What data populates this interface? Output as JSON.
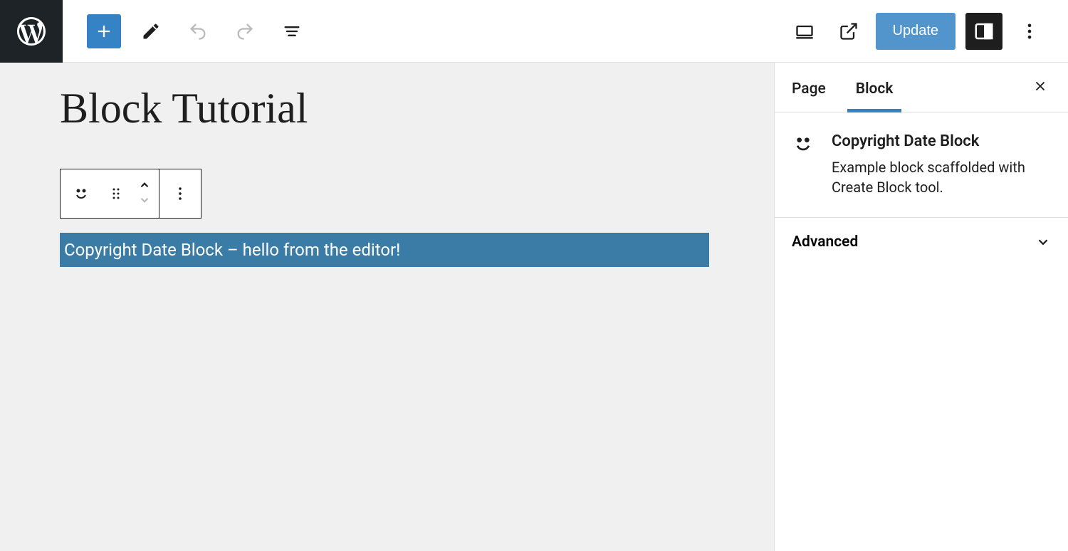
{
  "header": {
    "update_label": "Update"
  },
  "canvas": {
    "page_title": "Block Tutorial",
    "selected_block_text": "Copyright Date Block – hello from the editor!"
  },
  "sidebar": {
    "tabs": {
      "page": "Page",
      "block": "Block"
    },
    "block_info": {
      "title": "Copyright Date Block",
      "description": "Example block scaffolded with Create Block tool."
    },
    "panels": {
      "advanced": "Advanced"
    }
  }
}
